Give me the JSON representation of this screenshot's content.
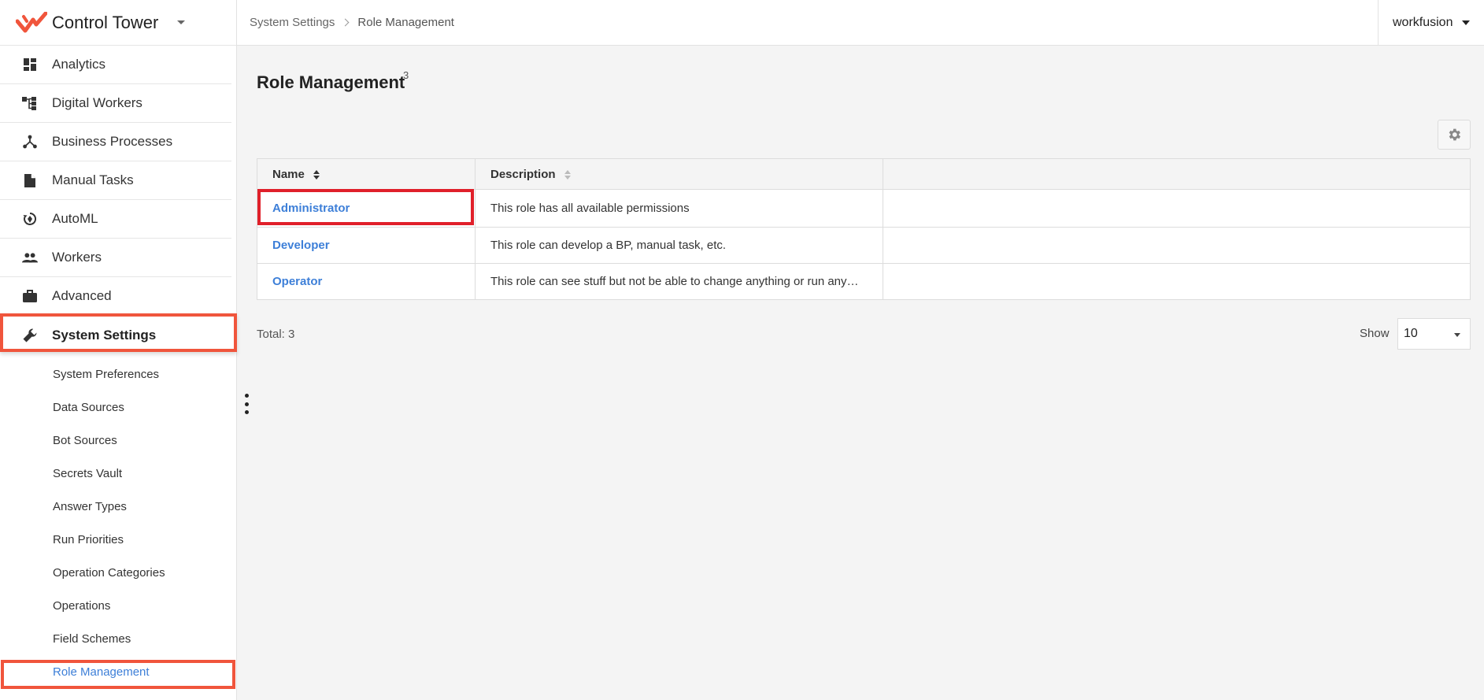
{
  "app": {
    "title": "Control Tower",
    "brand_color": "#f0553c"
  },
  "sidebar": {
    "items": [
      {
        "label": "Analytics",
        "icon": "dashboard-icon"
      },
      {
        "label": "Digital Workers",
        "icon": "hierarchy-icon"
      },
      {
        "label": "Business Processes",
        "icon": "process-icon"
      },
      {
        "label": "Manual Tasks",
        "icon": "document-icon"
      },
      {
        "label": "AutoML",
        "icon": "automl-icon"
      },
      {
        "label": "Workers",
        "icon": "people-icon"
      },
      {
        "label": "Advanced",
        "icon": "briefcase-icon"
      },
      {
        "label": "System Settings",
        "icon": "wrench-icon",
        "active": true
      }
    ],
    "subitems": [
      {
        "label": "System Preferences"
      },
      {
        "label": "Data Sources"
      },
      {
        "label": "Bot Sources"
      },
      {
        "label": "Secrets Vault"
      },
      {
        "label": "Answer Types"
      },
      {
        "label": "Run Priorities"
      },
      {
        "label": "Operation Categories"
      },
      {
        "label": "Operations"
      },
      {
        "label": "Field Schemes"
      },
      {
        "label": "Role Management",
        "active": true
      }
    ]
  },
  "header": {
    "breadcrumb": [
      "System Settings",
      "Role Management"
    ],
    "user": "workfusion"
  },
  "main": {
    "title": "Role Management",
    "count": "3",
    "table": {
      "columns": [
        "Name",
        "Description"
      ],
      "rows": [
        {
          "name": "Administrator",
          "description": "This role has all available permissions"
        },
        {
          "name": "Developer",
          "description": "This role can develop a BP, manual task, etc."
        },
        {
          "name": "Operator",
          "description": "This role can see stuff but not be able to change anything or run any…"
        }
      ]
    },
    "total": "Total: 3",
    "show_label": "Show",
    "page_size": "10"
  },
  "colors": {
    "link": "#3d7fd8",
    "highlight_red": "#e0202a",
    "highlight_orange": "#f0553c"
  }
}
